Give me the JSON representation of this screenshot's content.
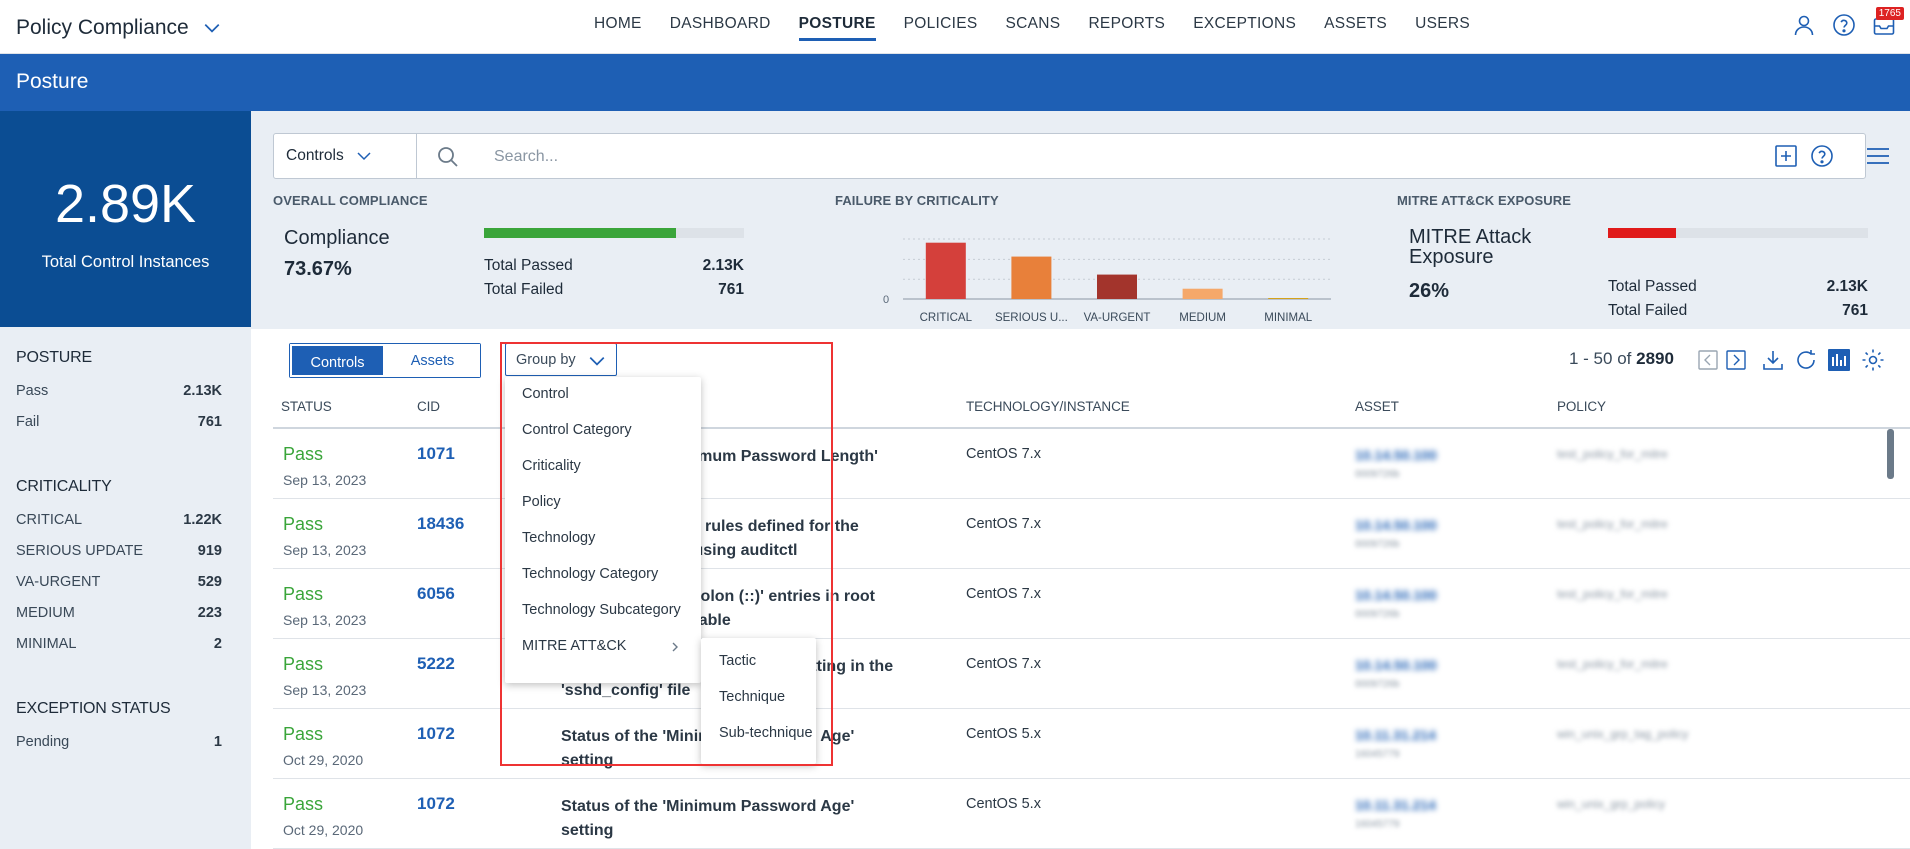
{
  "app": {
    "title": "Policy Compliance"
  },
  "nav": {
    "items": [
      "HOME",
      "DASHBOARD",
      "POSTURE",
      "POLICIES",
      "SCANS",
      "REPORTS",
      "EXCEPTIONS",
      "ASSETS",
      "USERS"
    ],
    "active": "POSTURE"
  },
  "top_icons": {
    "notifications_count": "1765"
  },
  "banner": {
    "title": "Posture"
  },
  "kpi": {
    "value": "2.89K",
    "label": "Total Control Instances"
  },
  "left_panel": {
    "posture": {
      "heading": "POSTURE",
      "rows": [
        {
          "label": "Pass",
          "value": "2.13K"
        },
        {
          "label": "Fail",
          "value": "761"
        }
      ]
    },
    "criticality": {
      "heading": "CRITICALITY",
      "rows": [
        {
          "label": "CRITICAL",
          "value": "1.22K"
        },
        {
          "label": "SERIOUS UPDATE",
          "value": "919"
        },
        {
          "label": "VA-URGENT",
          "value": "529"
        },
        {
          "label": "MEDIUM",
          "value": "223"
        },
        {
          "label": "MINIMAL",
          "value": "2"
        }
      ]
    },
    "exception": {
      "heading": "EXCEPTION STATUS",
      "rows": [
        {
          "label": "Pending",
          "value": "1"
        }
      ]
    }
  },
  "search": {
    "selector": "Controls",
    "placeholder": "Search..."
  },
  "overall": {
    "heading": "OVERALL COMPLIANCE",
    "label": "Compliance",
    "value": "73.67%",
    "progress": 0.74,
    "bar_color": "#3aa53a",
    "passed_label": "Total Passed",
    "passed": "2.13K",
    "failed_label": "Total Failed",
    "failed": "761"
  },
  "failure": {
    "heading": "FAILURE BY CRITICALITY",
    "zero_label": "0"
  },
  "chart_data": {
    "type": "bar",
    "categories": [
      "CRITICAL",
      "SERIOUS U...",
      "VA-URGENT",
      "MEDIUM",
      "MINIMAL"
    ],
    "values": [
      1220,
      919,
      529,
      223,
      2
    ],
    "colors": [
      "#d4403b",
      "#e8803a",
      "#a3342c",
      "#f5a86a",
      "#d4a21a"
    ],
    "ylim": [
      0,
      1300
    ]
  },
  "mitre": {
    "heading": "MITRE ATT&CK EXPOSURE",
    "label_line1": "MITRE Attack",
    "label_line2": "Exposure",
    "value": "26%",
    "progress": 0.26,
    "bar_color": "#e01a1a",
    "passed_label": "Total Passed",
    "passed": "2.13K",
    "failed_label": "Total Failed",
    "failed": "761"
  },
  "view_tabs": {
    "controls": "Controls",
    "assets": "Assets"
  },
  "group_by": {
    "label": "Group by",
    "options": [
      "Control",
      "Control Category",
      "Criticality",
      "Policy",
      "Technology",
      "Technology Category",
      "Technology Subcategory",
      "MITRE ATT&CK"
    ],
    "sub_options": [
      "Tactic",
      "Technique",
      "Sub-technique"
    ]
  },
  "pager": {
    "range": "1 - 50 of",
    "total": "2890"
  },
  "table": {
    "headers": {
      "status": "STATUS",
      "cid": "CID",
      "tech": "TECHNOLOGY/INSTANCE",
      "asset": "ASSET",
      "policy": "POLICY"
    },
    "rows": [
      {
        "status": "Pass",
        "date": "Sep 13, 2023",
        "cid": "1071",
        "control": "Status of the 'Minimum Password Length'",
        "tech": "CentOS 7.x",
        "asset": "10.14.50.100",
        "asset_sub": "0009726b",
        "policy": "test_policy_for_mitre"
      },
      {
        "status": "Pass",
        "date": "Sep 13, 2023",
        "cid": "18436",
        "control": "Status of the audit rules defined for the audit_parameter, using auditctl",
        "tech": "CentOS 7.x",
        "asset": "10.14.50.100",
        "asset_sub": "0009726b",
        "policy": "test_policy_for_mitre"
      },
      {
        "status": "Pass",
        "date": "Sep 13, 2023",
        "cid": "6056",
        "control": "Status of double-colon (::)' entries in root user's $PATH' variable",
        "tech": "CentOS 7.x",
        "asset": "10.14.50.100",
        "asset_sub": "0009726b",
        "policy": "test_policy_for_mitre"
      },
      {
        "status": "Pass",
        "date": "Sep 13, 2023",
        "cid": "5222",
        "control": "Status of the 'X11 Forwarding' setting in the 'sshd_config' file",
        "tech": "CentOS 7.x",
        "asset": "10.14.50.100",
        "asset_sub": "0009726b",
        "policy": "test_policy_for_mitre"
      },
      {
        "status": "Pass",
        "date": "Oct 29, 2020",
        "cid": "1072",
        "control": "Status of the 'Minimum Password Age' setting",
        "tech": "CentOS 5.x",
        "asset": "10.11.31.214",
        "asset_sub": "16045779",
        "policy": "win_unix_grp_tag_policy"
      },
      {
        "status": "Pass",
        "date": "Oct 29, 2020",
        "cid": "1072",
        "control": "Status of the 'Minimum Password Age' setting",
        "tech": "CentOS 5.x",
        "asset": "10.11.31.214",
        "asset_sub": "16045779",
        "policy": "win_unix_grp_policy"
      }
    ]
  }
}
